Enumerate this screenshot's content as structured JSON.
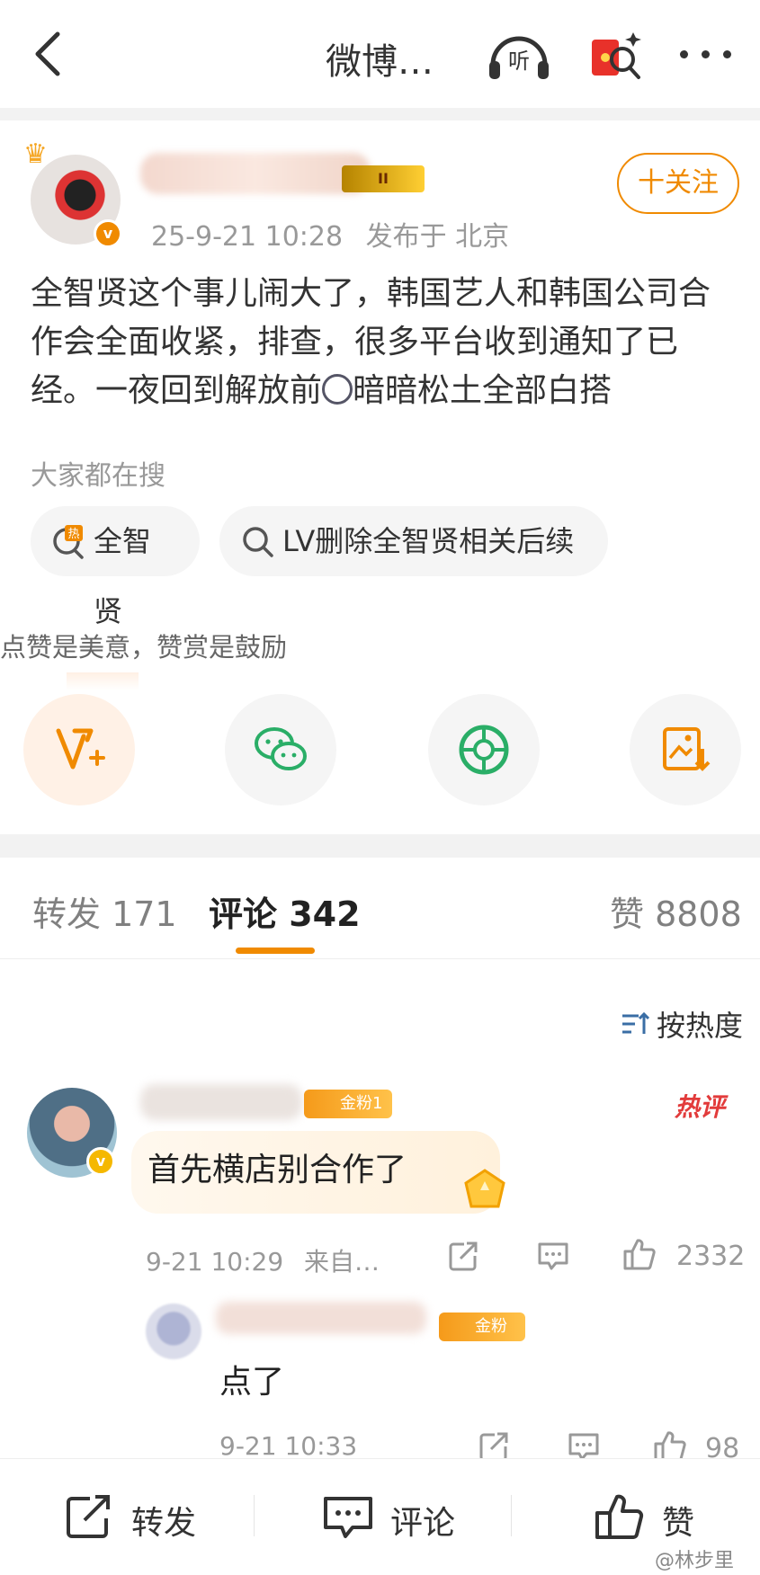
{
  "header": {
    "title": "微博…",
    "back_icon": "back-arrow-icon",
    "listen_label": "听",
    "listen_icon": "headphones-icon",
    "redpack_icon": "red-packet-search-icon",
    "more_icon": "more-dots-icon"
  },
  "post": {
    "crown_icon": "crown-icon",
    "verified_mark": "v",
    "level_badge": "II",
    "follow_label": "十关注",
    "time": "25-9-21 10:28",
    "location": "发布于 北京",
    "text_before_emoji": "全智贤这个事儿闹大了，韩国艺人和韩国公司合作会全面收紧，排查，很多平台收到通知了已经。一夜回到解放前",
    "text_after_emoji": "暗暗松土全部白搭"
  },
  "trending": {
    "label": "大家都在搜",
    "items": [
      {
        "label": "全智贤",
        "icon": "hot-search-icon"
      },
      {
        "label": "LV删除全智贤相关后续",
        "icon": "search-icon"
      }
    ]
  },
  "reward": {
    "note": "点赞是美意，赞赏是鼓励",
    "share_targets": [
      "v-plus-reward-icon",
      "wechat-icon",
      "moments-icon",
      "save-image-icon"
    ]
  },
  "tabs": {
    "repost": "转发 171",
    "comments": "评论 342",
    "likes": "赞 8808"
  },
  "sort_label": "按热度",
  "comments": [
    {
      "fan_badge": "金粉1",
      "hot_tag": "热评",
      "verified_mark": "v",
      "text": "首先横店别合作了",
      "time": "9-21 10:29",
      "source": "来自…",
      "likes": "2332",
      "reply": {
        "fan_badge": "金粉1",
        "text": "点了",
        "time": "9-21 10:33",
        "likes": "98"
      }
    }
  ],
  "bottom_bar": {
    "repost": "转发",
    "comment": "评论",
    "like": "赞"
  },
  "watermark": "@林步里",
  "colors": {
    "accent": "#f08a00",
    "wechat": "#2aae67",
    "hot": "#e23b3b"
  }
}
